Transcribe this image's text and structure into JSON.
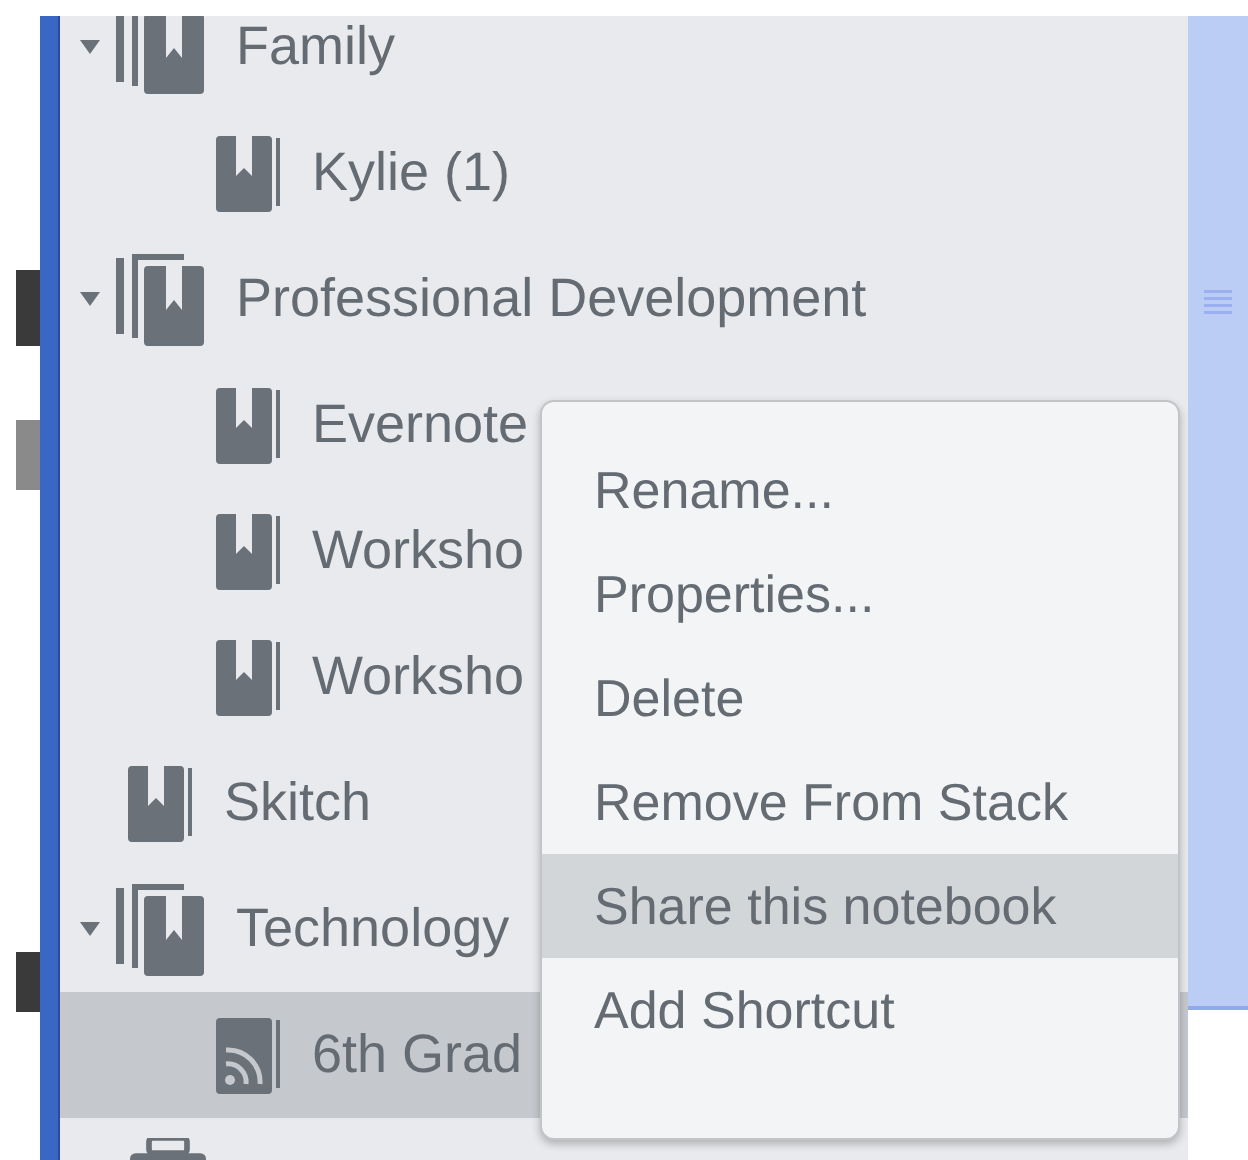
{
  "sidebar": {
    "items": [
      {
        "label": "Family",
        "kind": "stack",
        "expanded": true,
        "selected": false,
        "children": [
          {
            "label": "Kylie (1)",
            "kind": "notebook",
            "selected": false
          }
        ]
      },
      {
        "label": "Professional Development",
        "kind": "stack",
        "expanded": true,
        "selected": false,
        "children": [
          {
            "label": "Evernote",
            "kind": "notebook",
            "selected": false
          },
          {
            "label": "Worksho",
            "kind": "notebook",
            "selected": false
          },
          {
            "label": "Worksho",
            "kind": "notebook",
            "selected": false
          }
        ]
      },
      {
        "label": "Skitch",
        "kind": "notebook",
        "selected": false
      },
      {
        "label": "Technology",
        "kind": "stack",
        "expanded": true,
        "selected": false,
        "children": [
          {
            "label": "6th Grad",
            "kind": "shared",
            "selected": true
          }
        ]
      }
    ]
  },
  "context_menu": {
    "items": [
      {
        "label": "Rename...",
        "highlighted": false
      },
      {
        "label": "Properties...",
        "highlighted": false
      },
      {
        "label": "Delete",
        "highlighted": false
      },
      {
        "label": "Remove From Stack",
        "highlighted": false
      },
      {
        "label": "Share this notebook",
        "highlighted": true
      },
      {
        "label": "Add Shortcut",
        "highlighted": false
      }
    ]
  }
}
